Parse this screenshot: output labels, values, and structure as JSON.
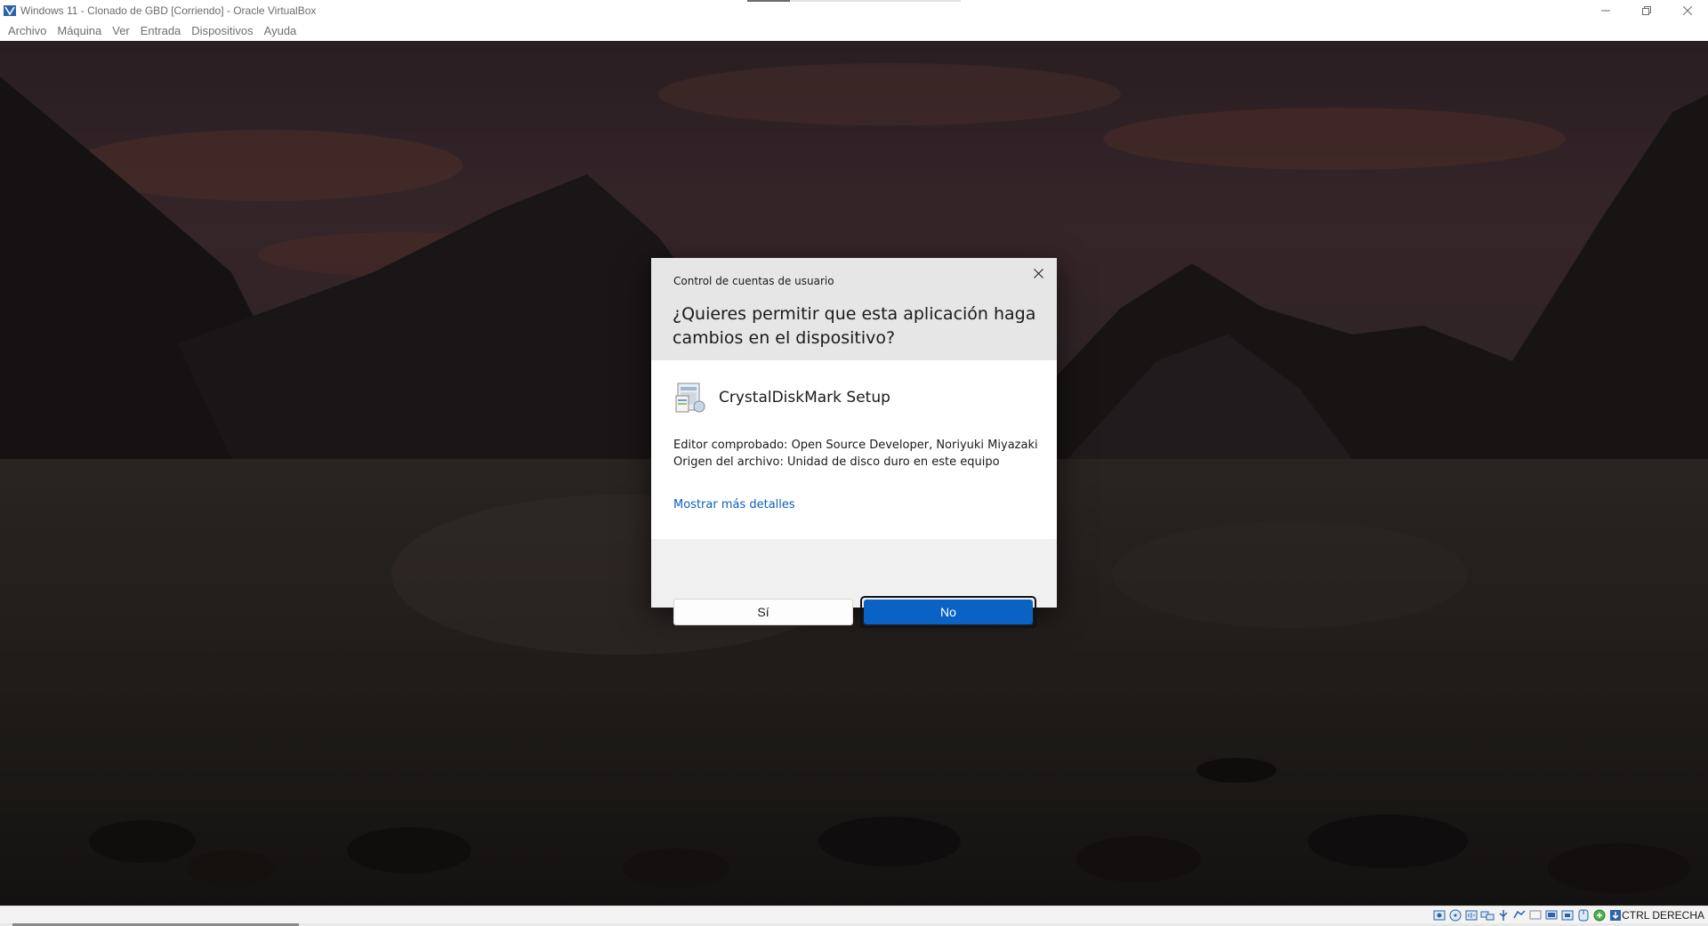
{
  "window": {
    "title": "Windows 11 - Clonado de GBD [Corriendo] - Oracle VirtualBox",
    "controls": [
      "minimize-icon",
      "restore-icon",
      "close-icon"
    ]
  },
  "menu": {
    "items": [
      "Archivo",
      "Máquina",
      "Ver",
      "Entrada",
      "Dispositivos",
      "Ayuda"
    ]
  },
  "dialog": {
    "caption": "Control de cuentas de usuario",
    "question": "¿Quieres permitir que esta aplicación haga cambios en el dispositivo?",
    "app_name": "CrystalDiskMark Setup",
    "publisher_line": "Editor comprobado: Open Source Developer, Noriyuki Miyazaki",
    "origin_line": "Origen del archivo: Unidad de disco duro en este equipo",
    "details_link": "Mostrar más detalles",
    "yes_label": "Sí",
    "no_label": "No",
    "accent_color": "#0a62c4",
    "link_color": "#0b5fb8"
  },
  "statusbar": {
    "host_key": "CTRL DERECHA",
    "icons": [
      "hard-disk-icon",
      "optical-drive-icon",
      "audio-icon",
      "network-icon",
      "usb-icon",
      "shared-folders-icon",
      "display-icon",
      "video-capture-icon",
      "recording-icon",
      "mouse-integration-icon",
      "keyboard-icon"
    ]
  }
}
